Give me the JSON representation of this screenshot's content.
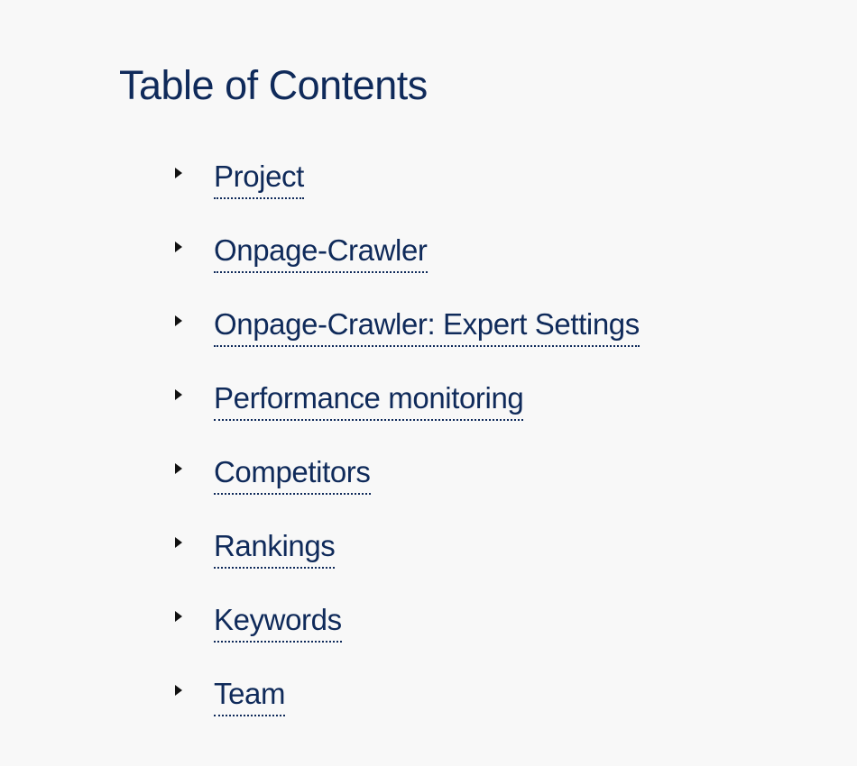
{
  "toc": {
    "title": "Table of Contents",
    "items": [
      {
        "label": "Project",
        "icon": "caret-right-icon"
      },
      {
        "label": "Onpage-Crawler",
        "icon": "caret-right-icon"
      },
      {
        "label": "Onpage-Crawler: Expert Settings",
        "icon": "caret-right-icon"
      },
      {
        "label": "Performance monitoring",
        "icon": "caret-right-icon"
      },
      {
        "label": "Competitors",
        "icon": "caret-right-icon"
      },
      {
        "label": "Rankings",
        "icon": "caret-right-icon"
      },
      {
        "label": "Keywords",
        "icon": "caret-right-icon"
      },
      {
        "label": "Team",
        "icon": "caret-right-icon"
      }
    ]
  },
  "colors": {
    "heading": "#0f2a5a",
    "link": "#0f2a5a",
    "caret": "#111111",
    "background": "#f8f8f8"
  }
}
